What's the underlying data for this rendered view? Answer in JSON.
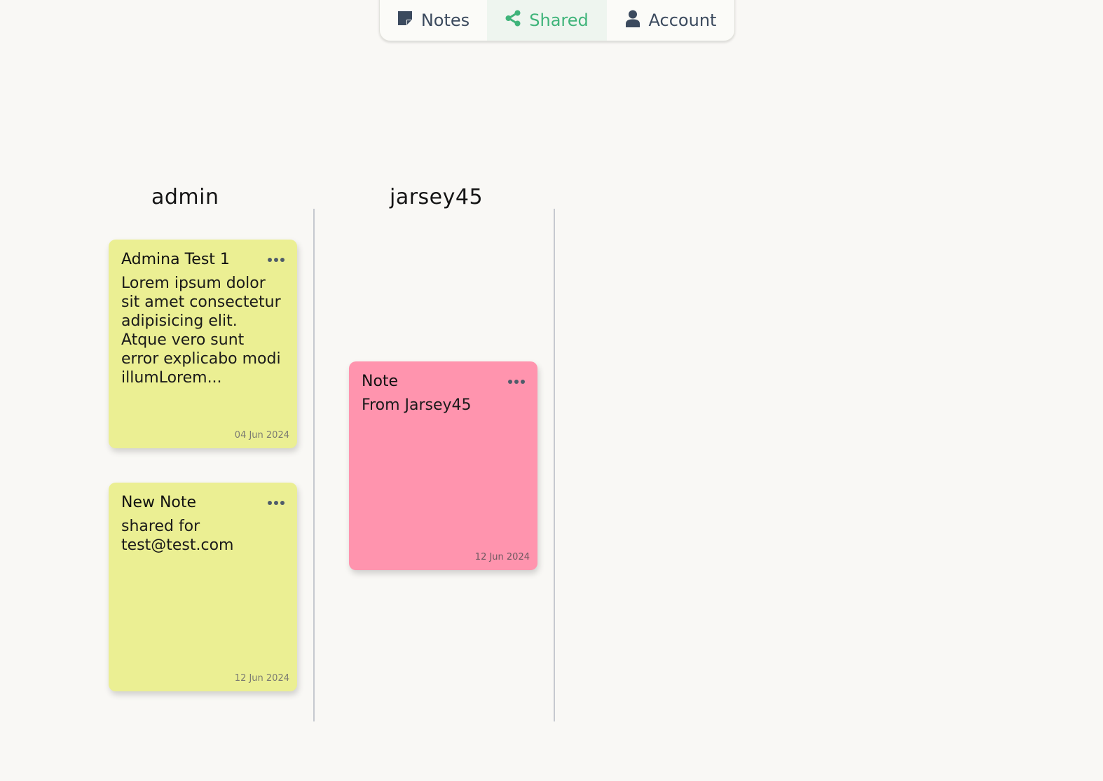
{
  "nav": {
    "tabs": [
      {
        "label": "Notes",
        "icon": "sticky-note-icon"
      },
      {
        "label": "Shared",
        "icon": "share-icon",
        "active": true
      },
      {
        "label": "Account",
        "icon": "user-icon"
      }
    ],
    "active_color": "#3fb47a"
  },
  "columns": [
    {
      "owner": "admin",
      "notes": [
        {
          "title": "Admina Test 1",
          "body": "Lorem ipsum dolor sit amet consectetur adipisicing elit. Atque vero sunt error explicabo modi illumLorem...",
          "date": "04 Jun 2024",
          "color": "#ebef93"
        },
        {
          "title": "New Note",
          "body": "shared for test@test.com",
          "date": "12 Jun 2024",
          "color": "#ebef93"
        }
      ]
    },
    {
      "owner": "jarsey45",
      "notes": [
        {
          "title": "Note",
          "body": "From Jarsey45",
          "date": "12 Jun 2024",
          "color": "#ff94ae"
        }
      ]
    }
  ]
}
